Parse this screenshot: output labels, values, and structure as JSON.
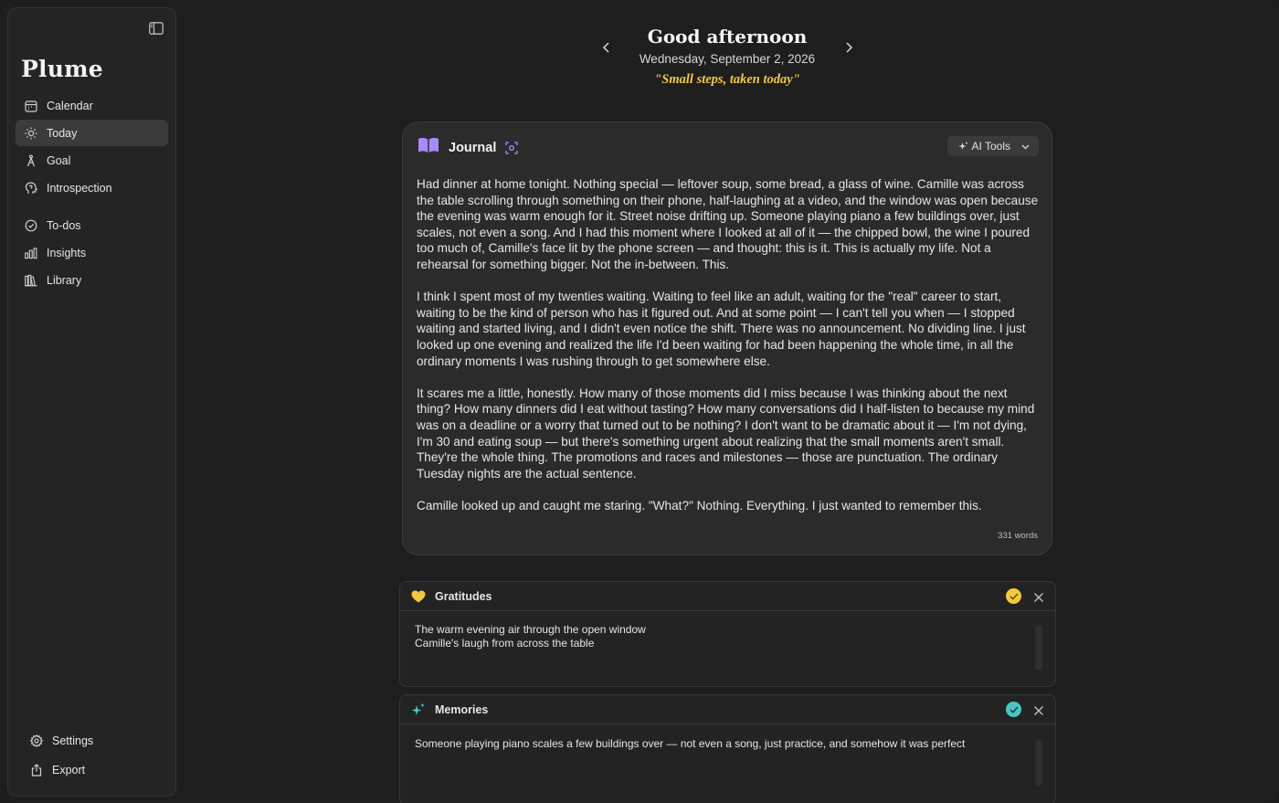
{
  "app": {
    "name": "Plume"
  },
  "sidebar": {
    "nav": [
      {
        "id": "calendar",
        "label": "Calendar",
        "icon": "calendar-icon"
      },
      {
        "id": "today",
        "label": "Today",
        "icon": "sun-icon",
        "active": true
      },
      {
        "id": "goal",
        "label": "Goal",
        "icon": "compass-icon"
      },
      {
        "id": "introspection",
        "label": "Introspection",
        "icon": "head-icon"
      },
      {
        "id": "todos",
        "label": "To-dos",
        "icon": "check-circle-icon"
      },
      {
        "id": "insights",
        "label": "Insights",
        "icon": "bar-chart-icon"
      },
      {
        "id": "library",
        "label": "Library",
        "icon": "books-icon"
      }
    ],
    "bottom": [
      {
        "id": "settings",
        "label": "Settings",
        "icon": "gear-icon"
      },
      {
        "id": "export",
        "label": "Export",
        "icon": "share-icon"
      }
    ]
  },
  "header": {
    "greeting": "Good afternoon",
    "date": "Wednesday, September 2, 2026",
    "quote": "\"Small steps, taken today\""
  },
  "journal": {
    "title": "Journal",
    "ai_tools_label": "AI Tools",
    "paragraphs": [
      "Had dinner at home tonight. Nothing special — leftover soup, some bread, a glass of wine. Camille was across the table scrolling through something on their phone, half-laughing at a video, and the window was open because the evening was warm enough for it. Street noise drifting up. Someone playing piano a few buildings over, just scales, not even a song. And I had this moment where I looked at all of it — the chipped bowl, the wine I poured too much of, Camille's face lit by the phone screen — and thought: this is it. This is actually my life. Not a rehearsal for something bigger. Not the in-between. This.",
      "I think I spent most of my twenties waiting. Waiting to feel like an adult, waiting for the \"real\" career to start, waiting to be the kind of person who has it figured out. And at some point — I can't tell you when — I stopped waiting and started living, and I didn't even notice the shift. There was no announcement. No dividing line. I just looked up one evening and realized the life I'd been waiting for had been happening the whole time, in all the ordinary moments I was rushing through to get somewhere else.",
      "It scares me a little, honestly. How many of those moments did I miss because I was thinking about the next thing? How many dinners did I eat without tasting? How many conversations did I half-listen to because my mind was on a deadline or a worry that turned out to be nothing? I don't want to be dramatic about it — I'm not dying, I'm 30 and eating soup — but there's something urgent about realizing that the small moments aren't small. They're the whole thing. The promotions and races and milestones — those are punctuation. The ordinary Tuesday nights are the actual sentence.",
      "Camille looked up and caught me staring. \"What?\" Nothing. Everything. I just wanted to remember this."
    ],
    "word_count": "331 words"
  },
  "gratitudes": {
    "title": "Gratitudes",
    "icon": "heart-icon",
    "check_color": "#f0c93a",
    "items": [
      "The warm evening air through the open window",
      "Camille's laugh from across the table"
    ]
  },
  "memories": {
    "title": "Memories",
    "icon": "sparkle-icon",
    "check_color": "#4cc5c0",
    "items": [
      "Someone playing piano scales a few buildings over — not even a song, just practice, and somehow it was perfect"
    ]
  },
  "colors": {
    "accent_quote": "#f0c84a",
    "journal_icon": "#a78bfa",
    "heart": "#f2c744",
    "sparkle": "#4cc5c0"
  }
}
